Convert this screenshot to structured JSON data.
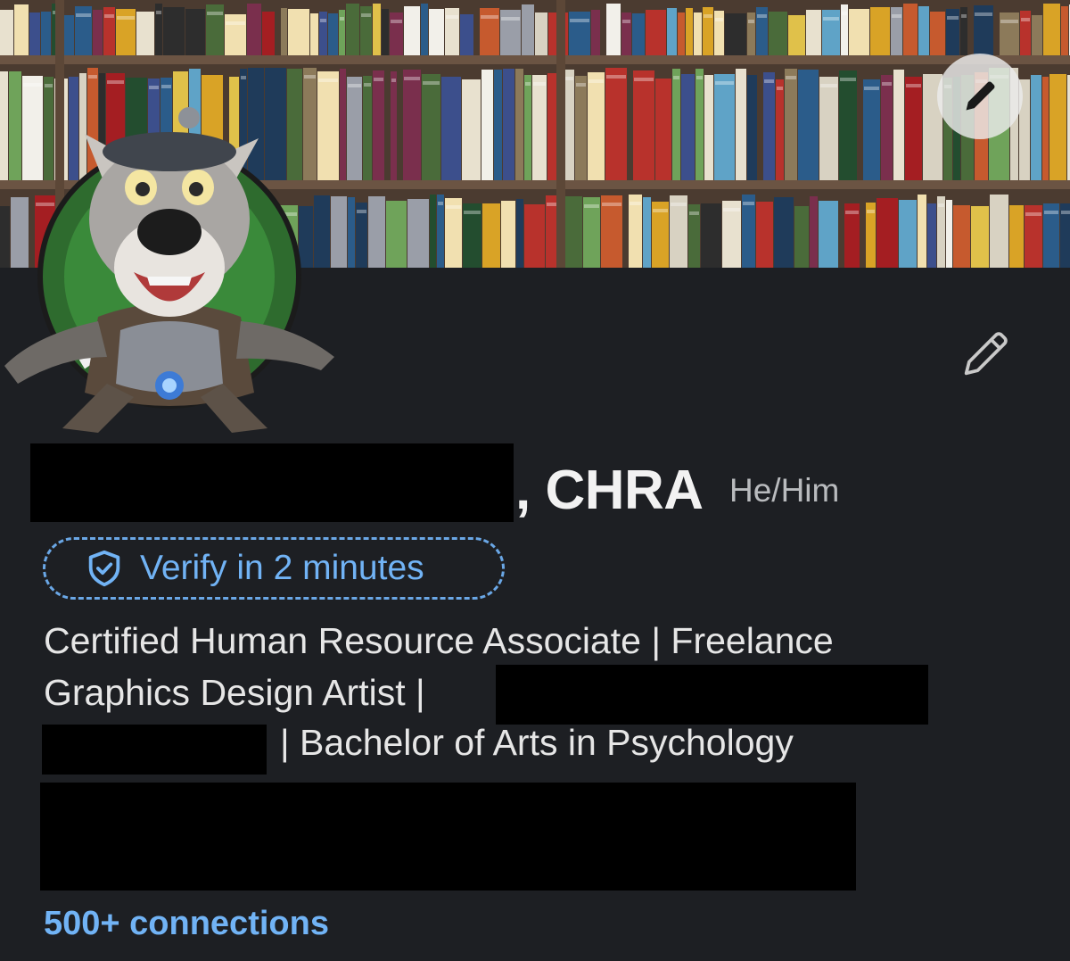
{
  "profile": {
    "name_suffix": ", CHRA",
    "pronouns": "He/Him",
    "verify_label": "Verify in 2 minutes",
    "headline_line1": "Certified Human Resource Associate | Freelance",
    "headline_line2": "Graphics Design Artist |",
    "headline_line3": "| Bachelor of Arts in Psychology",
    "connections": "500+ connections"
  },
  "icons": {
    "cover_edit": "pencil-icon",
    "profile_edit": "pencil-icon",
    "verify": "shield-check-icon"
  },
  "colors": {
    "background": "#1d1f23",
    "accent": "#71b3f5",
    "text_primary": "#f2f2f2",
    "text_secondary": "#b9bbbe",
    "redaction": "#000000"
  }
}
